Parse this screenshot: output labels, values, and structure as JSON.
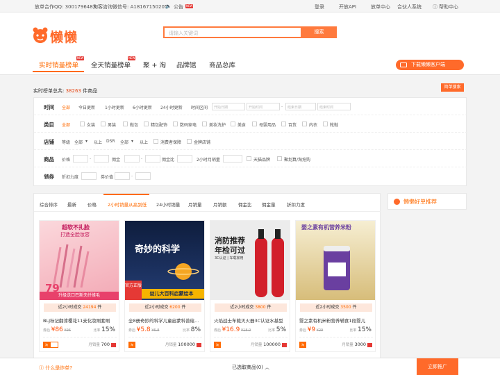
{
  "topbar": {
    "qq": "放单合作QQ: 3001796483",
    "wechat": "淘客咨询微信号: A18167150205",
    "notice": "公告",
    "notice_badge": "NEW",
    "links": [
      "登录",
      "开放API",
      "放单中心",
      "合伙人系统",
      "帮助中心"
    ]
  },
  "header": {
    "logo_text": "懒懒",
    "search_placeholder": "请输入关键词",
    "search_button": "搜索",
    "nav": [
      {
        "label": "实时销量榜单",
        "badge": "NEW"
      },
      {
        "label": "全天销量榜单",
        "badge": "NEW"
      },
      {
        "label": "聚 + 淘",
        "badge": ""
      },
      {
        "label": "品牌馆",
        "badge": ""
      },
      {
        "label": "商品总库",
        "badge": ""
      }
    ],
    "download": "下载懒懒客户端"
  },
  "summary": {
    "prefix": "实时榜单总共:",
    "count": "38263",
    "suffix": "件商品",
    "simple_search": "简单搜索"
  },
  "filters": {
    "time": {
      "label": "时间",
      "options": [
        "全部",
        "今日更新",
        "1小时更新",
        "6小时更新",
        "24小时更新",
        "时间区间"
      ],
      "start_placeholder": "开始日期",
      "start_time": "开始时间",
      "end_placeholder": "结束日期",
      "end_time": "结束时间"
    },
    "category": {
      "label": "类目",
      "all": "全部",
      "options": [
        "女装",
        "男装",
        "鞋包",
        "精包配饰",
        "数码家电",
        "美妆洗护",
        "美食",
        "母婴用品",
        "百货",
        "内衣",
        "靴鞋"
      ]
    },
    "shop": {
      "label": "店铺",
      "level": "等级",
      "level_val": "全部",
      "above1": "以上",
      "dsr": "DSR",
      "dsr_val": "全部",
      "above2": "以上",
      "opts": [
        "消费者保障",
        "金牌店铺"
      ]
    },
    "goods": {
      "label": "商品",
      "price": "价格",
      "commission": "佣金",
      "ratio": "佣金比",
      "sales2h": "2小时月销量",
      "opts": [
        "天猫品牌",
        "聚划算/淘抢购"
      ]
    },
    "coupon": {
      "label": "领券",
      "discount": "折扣力度",
      "value": "券价值"
    }
  },
  "sort_tabs": [
    "综合排序",
    "最新",
    "价格",
    "2小时销量从高到低",
    "24小时销量",
    "月销量",
    "月销额",
    "佣金比",
    "佣金量",
    "折扣力度"
  ],
  "recommend": "懒懒好单推荐",
  "products": [
    {
      "sold_prefix": "近2小时成交",
      "sold": "24194",
      "sold_suffix": "件",
      "title": "BLJ标记翻漆樱花11支化妆刷套刷",
      "price_label": "券后",
      "price": "¥86",
      "orig": "¥96",
      "ratio_label": "比率",
      "ratio": "15%",
      "monthly_label": "月销量",
      "monthly": "700",
      "img_text1": "超软不扎脸",
      "img_text2": "打造全脸妆容",
      "img_price": "79",
      "img_footer": "升级送口巴斯夫纤维毛",
      "color": "#f8cfd3",
      "accent": "#e8416b"
    },
    {
      "sold_prefix": "近2小时成交",
      "sold": "6200",
      "sold_suffix": "件",
      "title": "全8册奇妙的科学儿童启蒙科普绘...",
      "price_label": "券后",
      "price": "¥5.8",
      "orig": "¥6.8",
      "ratio_label": "比率",
      "ratio": "8%",
      "monthly_label": "月销量",
      "monthly": "100000",
      "img_text1": "奇妙的科学",
      "img_text2": "幼儿大百科启蒙绘本",
      "img_price": "",
      "img_footer": "官方正版",
      "color": "#1a2b50",
      "accent": "#f5b400"
    },
    {
      "sold_prefix": "近2小时成交",
      "sold": "3800",
      "sold_suffix": "件",
      "title": "火焰战士车载灭火器3C认证水基型",
      "price_label": "券后",
      "price": "¥16.9",
      "orig": "¥18.9",
      "ratio_label": "比率",
      "ratio": "5%",
      "monthly_label": "月销量",
      "monthly": "100000",
      "img_text1": "消防推荐",
      "img_text2": "年检可过",
      "img_price": "",
      "img_footer": "3C认证 | 车载家用",
      "color": "#eeeeee",
      "accent": "#d21f2a"
    },
    {
      "sold_prefix": "近2小时成交",
      "sold": "3500",
      "sold_suffix": "件",
      "title": "婴之素有机米粉营养辅食1段婴儿",
      "price_label": "券后",
      "price": "¥9",
      "orig": "¥29",
      "ratio_label": "比率",
      "ratio": "15%",
      "monthly_label": "月销量",
      "monthly": "3000",
      "img_text1": "婴之素有机营养米粉",
      "img_text2": "",
      "img_price": "",
      "img_footer": "",
      "color": "#e8d7a8",
      "accent": "#6a3fa0"
    }
  ],
  "bottom": {
    "question": "什么是炸单?",
    "selected": "已选取商品(0)",
    "promote": "立即推广"
  }
}
